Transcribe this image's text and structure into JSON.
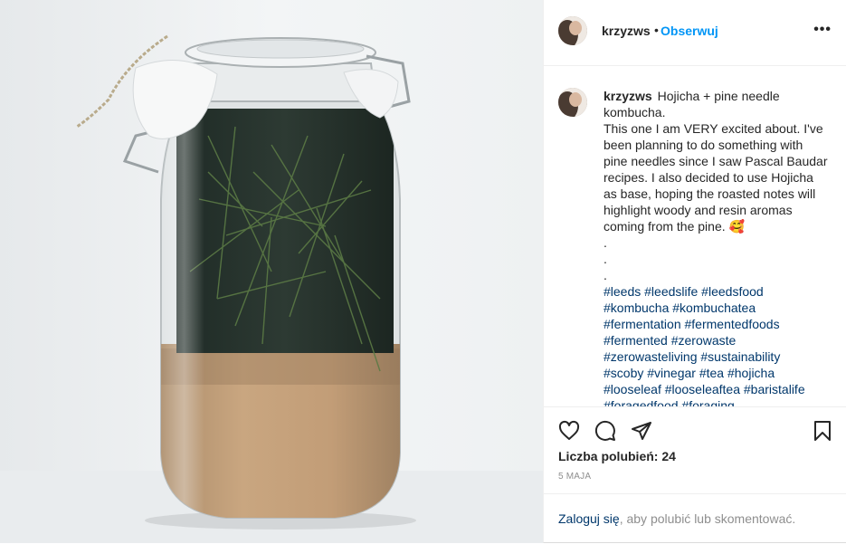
{
  "post": {
    "username": "krzyzws",
    "separator": "•",
    "follow_label": "Obserwuj",
    "more_label": "•••"
  },
  "caption": {
    "username": "krzyzws",
    "text": "Hojicha + pine needle kombucha.\nThis one I am VERY excited about. I've been planning to do something with pine needles since I saw Pascal Baudar recipes. I also decided to use Hojicha as base, hoping the roasted notes will highlight woody and resin aromas coming from the pine. 🥰\n.\n.\n.",
    "hashtags": "#leeds #leedslife #leedsfood\n#kombucha #kombuchatea\n#fermentation #fermentedfoods\n#fermented #zerowaste\n#zerowasteliving #sustainability\n#scoby #vinegar #tea #hojicha\n#looseleaf #looseleaftea #baristalife\n#foragedfood #foraging"
  },
  "actions": {
    "like_icon": "heart-icon",
    "comment_icon": "comment-icon",
    "share_icon": "paper-plane-icon",
    "save_icon": "bookmark-icon",
    "likes_text": "Liczba polubień: 24",
    "date": "5 MAJA"
  },
  "login": {
    "link_text": "Zaloguj się",
    "rest_text": ", aby polubić lub skomentować."
  },
  "colors": {
    "link_blue": "#0095f6",
    "hashtag": "#00376b",
    "muted": "#8e8e8e",
    "text": "#262626"
  }
}
